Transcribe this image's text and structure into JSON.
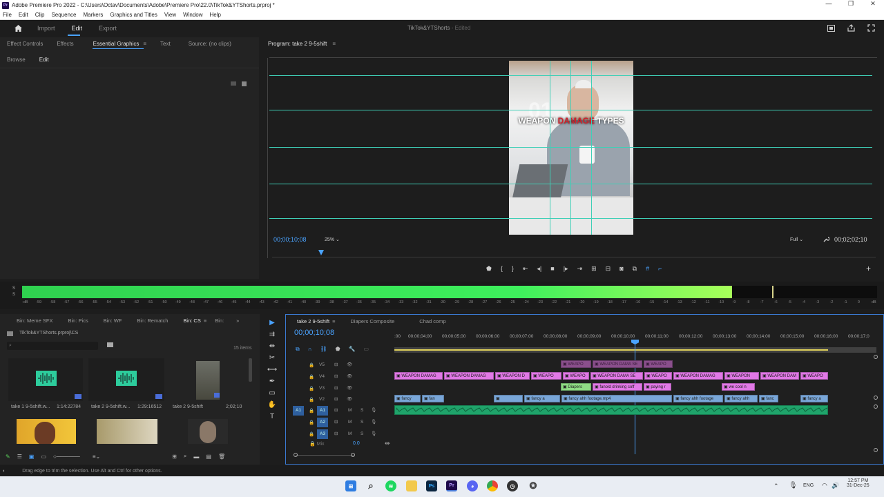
{
  "titlebar": {
    "title": "Adobe Premiere Pro 2022 - C:\\Users\\Octav\\Documents\\Adobe\\Premiere Pro\\22.0\\TikTok&YTShorts.prproj *",
    "logo": "Pr",
    "min": "—",
    "max": "❐",
    "close": "✕"
  },
  "menu": [
    "File",
    "Edit",
    "Clip",
    "Sequence",
    "Markers",
    "Graphics and Titles",
    "View",
    "Window",
    "Help"
  ],
  "workspace": {
    "tabs": [
      "Import",
      "Edit",
      "Export"
    ],
    "active": "Edit",
    "project_title": "TikTok&YTShorts",
    "project_status": "- Edited"
  },
  "left_panel": {
    "tabs": [
      "Effect Controls",
      "Effects",
      "Essential Graphics",
      "Text",
      "Source: (no clips)"
    ],
    "active": "Essential Graphics",
    "subtabs": [
      "Browse",
      "Edit"
    ],
    "active_subtab": "Edit"
  },
  "program": {
    "title": "Program: take 2 9-5shift",
    "timecode": "00;00;10;08",
    "zoom": "25%",
    "quality": "Full",
    "duration": "00;02;02;10",
    "overlay_text_1": "WEAPON ",
    "overlay_text_2": "DAMAGE",
    "overlay_text_3": " TYPES",
    "overlay_big": "01"
  },
  "audio_meter": {
    "level": 0.83,
    "labels": [
      "-dB",
      "-59",
      "-58",
      "-57",
      "-56",
      "-55",
      "-54",
      "-53",
      "-52",
      "-51",
      "-50",
      "-49",
      "-48",
      "-47",
      "-46",
      "-45",
      "-44",
      "-43",
      "-42",
      "-41",
      "-40",
      "-39",
      "-38",
      "-37",
      "-36",
      "-35",
      "-34",
      "-33",
      "-32",
      "-31",
      "-30",
      "-29",
      "-28",
      "-27",
      "-26",
      "-25",
      "-24",
      "-23",
      "-22",
      "-21",
      "-20",
      "-19",
      "-18",
      "-17",
      "-16",
      "-15",
      "-14",
      "-13",
      "-12",
      "-11",
      "-10",
      "-9",
      "-8",
      "-7",
      "-6",
      "-5",
      "-4",
      "-3",
      "-2",
      "-1",
      "0",
      "dB"
    ],
    "s1": "S",
    "s2": "S"
  },
  "bins": {
    "tabs": [
      "Bin: Meme SFX",
      "Bin: Pics",
      "Bin: WF",
      "Bin: Rematch",
      "Bin: CS",
      "Bin:"
    ],
    "active": "Bin: CS",
    "path": "TikTok&YTShorts.prproj\\CS",
    "count": "15 items",
    "items": [
      {
        "name": "take 1 9-5shift.w...",
        "duration": "1:14:22784"
      },
      {
        "name": "take 2 9-5shift.w...",
        "duration": "1:29:16512"
      },
      {
        "name": "take 2 9-5shift",
        "duration": "2;02;10"
      }
    ]
  },
  "timeline": {
    "tabs": [
      "take 2 9-5shift",
      "Diapers Composite",
      "Chad comp"
    ],
    "active": "take 2 9-5shift",
    "timecode": "00;00;10;08",
    "ruler": [
      ":00",
      "00;00;04;00",
      "00;00;05;00",
      "00;00;06;00",
      "00;00;07;00",
      "00;00;08;00",
      "00;00;09;00",
      "00;00;10;00",
      "00;00;11;00",
      "00;00;12;00",
      "00;00;13;00",
      "00;00;14;00",
      "00;00;15;00",
      "00;00;16;00",
      "00;00;17;0"
    ],
    "tracks": [
      "V5",
      "V4",
      "V3",
      "V2",
      "A1",
      "A2",
      "A3",
      "Mix"
    ],
    "src_patch": "A1",
    "track_btns": {
      "m": "M",
      "s": "S"
    },
    "mix_value": "0.0",
    "clips": {
      "v5": [
        {
          "label": "WEAPO"
        },
        {
          "label": "WEAPON DAMA SE"
        },
        {
          "label": "WEAPO"
        }
      ],
      "v4": [
        {
          "label": "WEAPON DAMAG"
        },
        {
          "label": "WEAPON DAMAG"
        },
        {
          "label": "WEAPON D"
        },
        {
          "label": "WEAPO"
        },
        {
          "label": "WEAPO"
        },
        {
          "label": "WEAPON DAMA SE"
        },
        {
          "label": "WEAPO"
        },
        {
          "label": "WEAPON DAMAG"
        },
        {
          "label": "WEAPON"
        },
        {
          "label": "WEAPON DAM"
        },
        {
          "label": "WEAPO"
        }
      ],
      "v3": [
        {
          "label": "Diapers"
        },
        {
          "label": "fanold drinking coff"
        },
        {
          "label": "paying r"
        },
        {
          "label": "we cool n"
        }
      ],
      "v2": [
        {
          "label": "fancy"
        },
        {
          "label": "fan"
        },
        {
          "label": ""
        },
        {
          "label": "fancy a"
        },
        {
          "label": "fancy ahh footage.mp4"
        },
        {
          "label": "fancy ahh footage"
        },
        {
          "label": "fancy ahh"
        },
        {
          "label": "fanc"
        },
        {
          "label": "fancy a"
        }
      ]
    }
  },
  "status": {
    "message": "Drag edge to trim the selection. Use Alt and Ctrl for other options."
  },
  "taskbar": {
    "lang": "ENG",
    "time": "12:57 PM",
    "date": "31-Dec-25"
  }
}
